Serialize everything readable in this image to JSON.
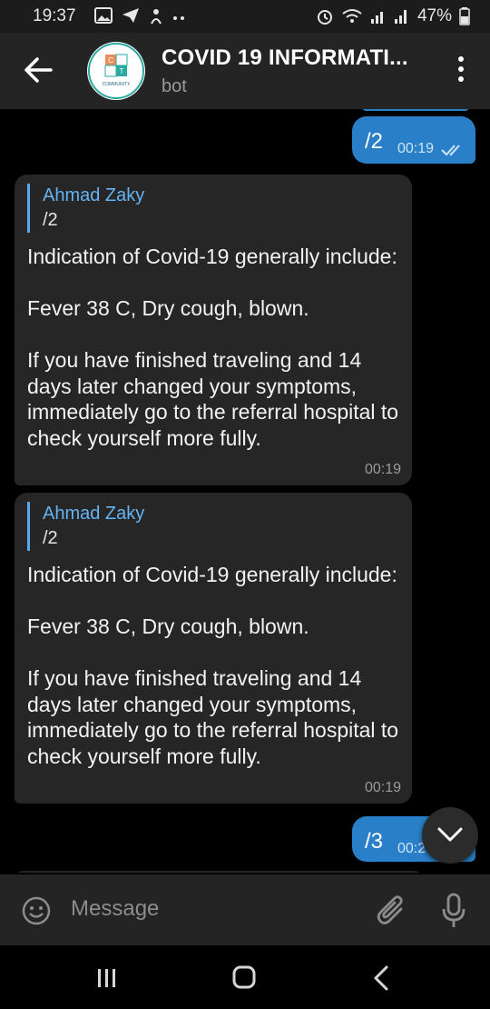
{
  "status_bar": {
    "time": "19:37",
    "battery_percent": "47%",
    "icons": [
      "gallery-icon",
      "telegram-send-icon",
      "cloud-icon",
      "more-dots-icon",
      "alarm-icon",
      "wifi-icon",
      "signal-icon",
      "signal-icon",
      "battery-icon"
    ]
  },
  "header": {
    "title": "COVID 19 INFORMATI...",
    "subtitle": "bot",
    "avatar_text": "COMMUNITY"
  },
  "messages": [
    {
      "direction": "out",
      "text": "/2",
      "time": "00:19",
      "status": "read"
    },
    {
      "direction": "in",
      "reply_to_name": "Ahmad Zaky",
      "reply_to_text": "/2",
      "text": "Indication of Covid-19 generally include:\n\nFever 38 C, Dry cough, blown.\n\nIf you have finished traveling and 14 days later changed your symptoms, immediately go to the referral hospital to check yourself more fully.",
      "time": "00:19"
    },
    {
      "direction": "in",
      "reply_to_name": "Ahmad Zaky",
      "reply_to_text": "/2",
      "text": "Indication of Covid-19 generally include:\n\nFever 38 C, Dry cough, blown.\n\nIf you have finished traveling and 14 days later changed your symptoms, immediately go to the referral hospital to check yourself more fully.",
      "time": "00:19"
    },
    {
      "direction": "out",
      "text": "/3",
      "time": "00:2"
    }
  ],
  "composer": {
    "placeholder": "Message"
  },
  "colors": {
    "accent": "#2a80c8",
    "link": "#64b3f4",
    "bubble_in": "#262626",
    "header": "#242424"
  }
}
